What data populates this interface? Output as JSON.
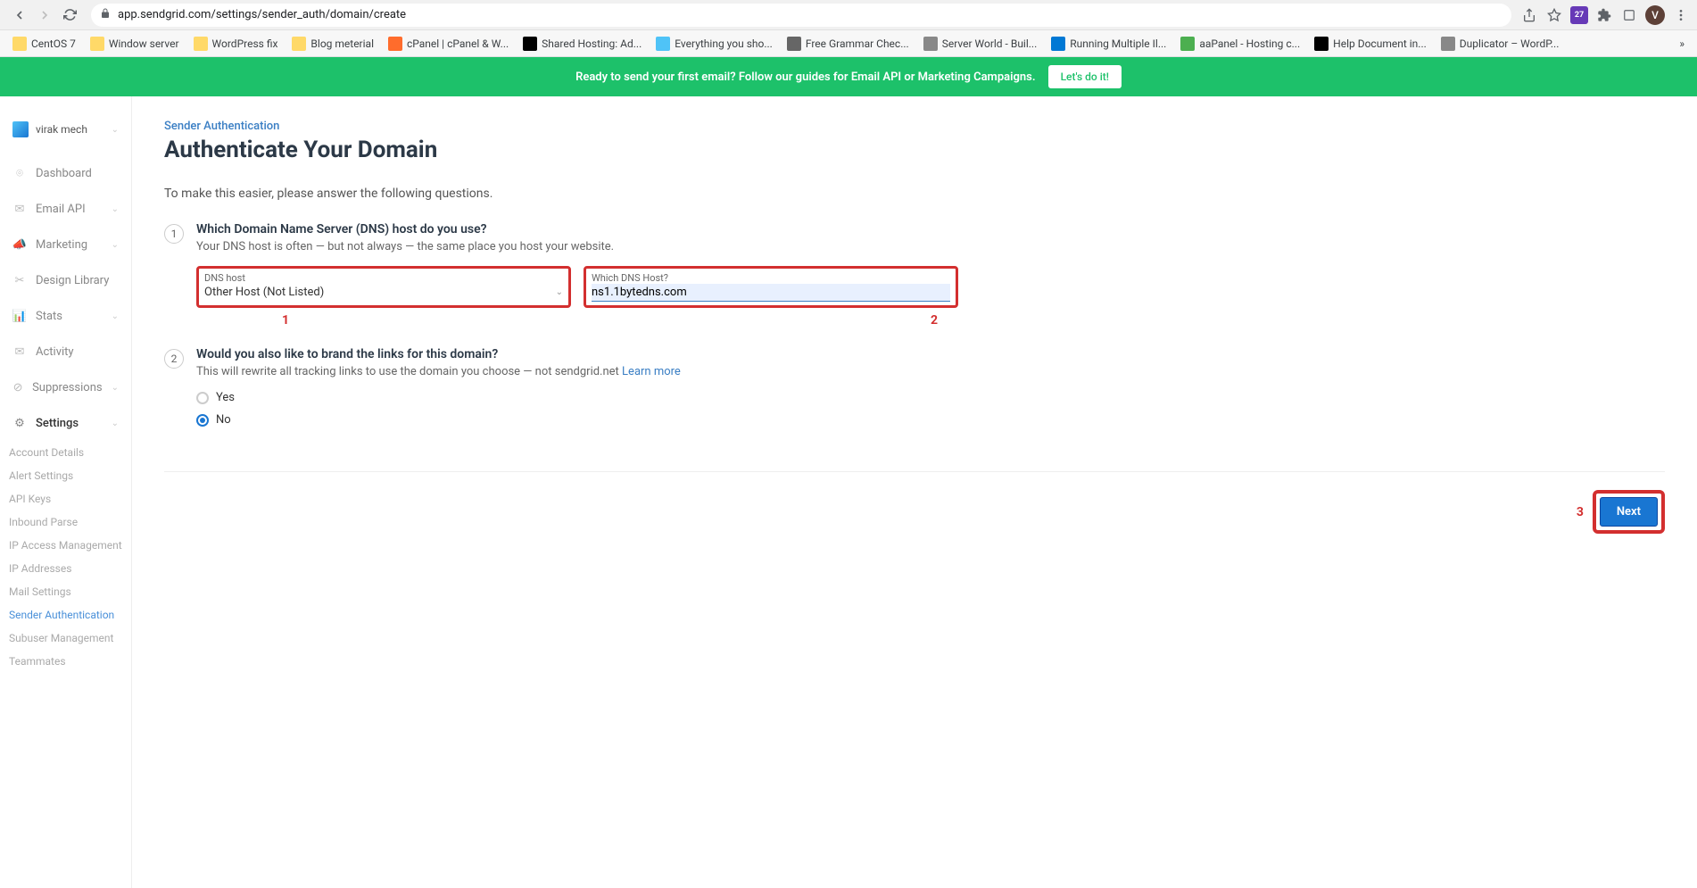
{
  "browser": {
    "url": "app.sendgrid.com/settings/sender_auth/domain/create",
    "avatar_initial": "V",
    "cal_badge": "27"
  },
  "bookmarks": [
    {
      "label": "CentOS 7",
      "kind": "folder"
    },
    {
      "label": "Window server",
      "kind": "folder"
    },
    {
      "label": "WordPress fix",
      "kind": "folder"
    },
    {
      "label": "Blog meterial",
      "kind": "folder"
    },
    {
      "label": "cPanel | cPanel & W...",
      "kind": "site",
      "color": "#ff6c2c"
    },
    {
      "label": "Shared Hosting: Ad...",
      "kind": "site",
      "color": "#000"
    },
    {
      "label": "Everything you sho...",
      "kind": "site",
      "color": "#4fc3f7"
    },
    {
      "label": "Free Grammar Chec...",
      "kind": "site",
      "color": "#666"
    },
    {
      "label": "Server World - Buil...",
      "kind": "site",
      "color": "#888"
    },
    {
      "label": "Running Multiple Il...",
      "kind": "site",
      "color": "#0078d4"
    },
    {
      "label": "aaPanel - Hosting c...",
      "kind": "site",
      "color": "#4caf50"
    },
    {
      "label": "Help Document in...",
      "kind": "site",
      "color": "#000"
    },
    {
      "label": "Duplicator – WordP...",
      "kind": "site",
      "color": "#888"
    }
  ],
  "banner": {
    "text": "Ready to send your first email? Follow our guides for Email API or Marketing Campaigns.",
    "cta": "Let's do it!"
  },
  "sidebar": {
    "account": "virak mech",
    "items": [
      {
        "label": "Dashboard",
        "icon": "⌾"
      },
      {
        "label": "Email API",
        "icon": "✉",
        "chev": true
      },
      {
        "label": "Marketing",
        "icon": "📣",
        "chev": true
      },
      {
        "label": "Design Library",
        "icon": "✂"
      },
      {
        "label": "Stats",
        "icon": "📊",
        "chev": true
      },
      {
        "label": "Activity",
        "icon": "✉"
      },
      {
        "label": "Suppressions",
        "icon": "⊘",
        "chev": true
      },
      {
        "label": "Settings",
        "icon": "⚙",
        "chev": true,
        "active": true
      }
    ],
    "subitems": [
      "Account Details",
      "Alert Settings",
      "API Keys",
      "Inbound Parse",
      "IP Access Management",
      "IP Addresses",
      "Mail Settings",
      "Sender Authentication",
      "Subuser Management",
      "Teammates"
    ],
    "active_sub": "Sender Authentication"
  },
  "main": {
    "breadcrumb": "Sender Authentication",
    "title": "Authenticate Your Domain",
    "intro": "To make this easier, please answer the following questions.",
    "step1": {
      "num": "1",
      "title": "Which Domain Name Server (DNS) host do you use?",
      "desc": "Your DNS host is often — but not always — the same place you host your website.",
      "dns_label": "DNS host",
      "dns_value": "Other Host (Not Listed)",
      "which_label": "Which DNS Host?",
      "which_value": "ns1.1bytedns.com",
      "callout1": "1",
      "callout2": "2"
    },
    "step2": {
      "num": "2",
      "title": "Would you also like to brand the links for this domain?",
      "desc_pre": "This will rewrite all tracking links to use the domain you choose — not sendgrid.net ",
      "learn_more": "Learn more",
      "yes": "Yes",
      "no": "No"
    },
    "footer": {
      "callout3": "3",
      "next": "Next"
    }
  }
}
